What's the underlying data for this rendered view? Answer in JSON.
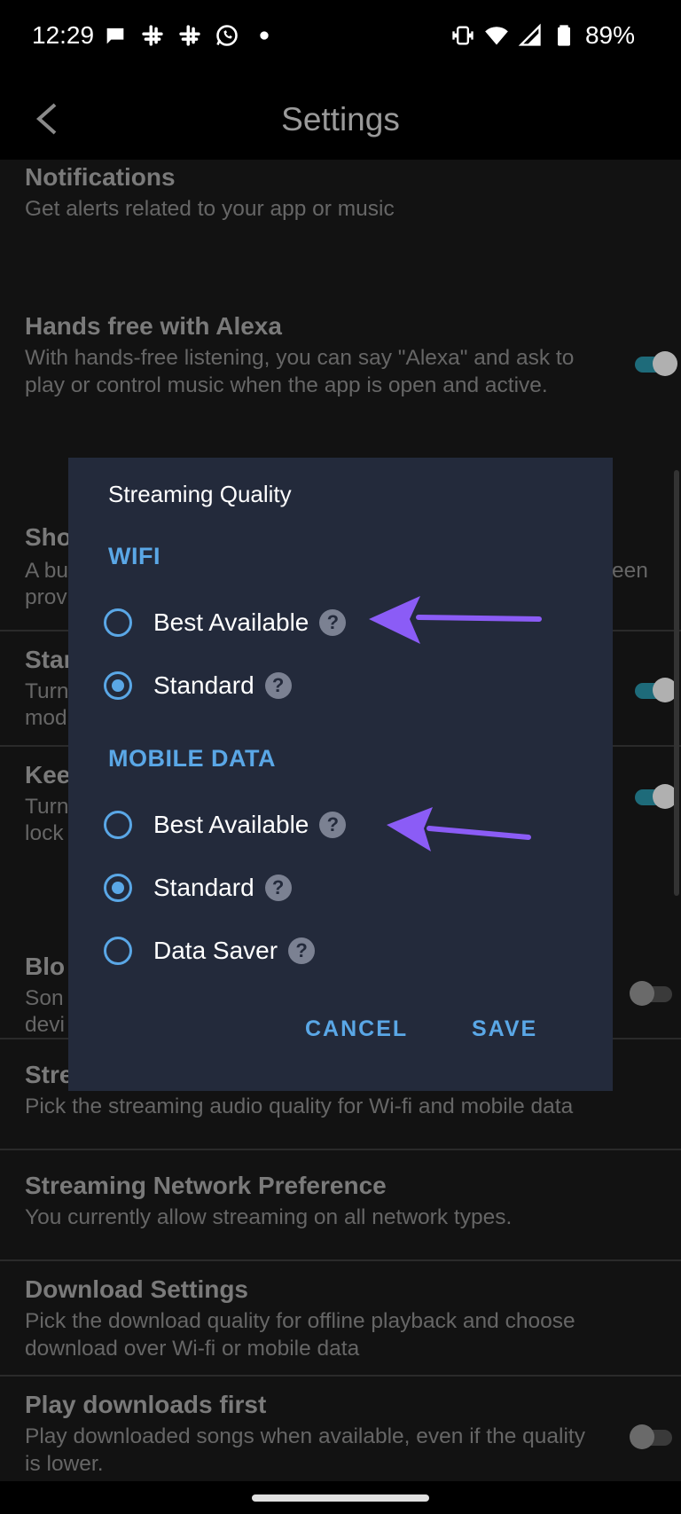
{
  "status_bar": {
    "time": "12:29",
    "battery": "89%",
    "icons": [
      "chat-bubble-icon",
      "slack-icon",
      "slack-icon",
      "whatsapp-icon",
      "dot-icon",
      "vibrate-icon",
      "wifi-icon",
      "signal-icon",
      "battery-icon"
    ]
  },
  "app_bar": {
    "title": "Settings",
    "back_icon": "chevron-left-icon"
  },
  "settings": {
    "notifications": {
      "title": "Notifications",
      "subtitle": "Get alerts related to your app or music"
    },
    "alexa": {
      "title": "Hands free with Alexa",
      "subtitle": "With hands-free listening, you can say \"Alexa\" and ask to play or control music when the app is open and active.",
      "toggle": "on"
    },
    "row3": {
      "title": "Sho",
      "subtitle_a": "A bu",
      "subtitle_b": "prov",
      "subtitle_right": "een"
    },
    "row4": {
      "title": "Star",
      "subtitle_a": "Turn",
      "subtitle_b": "mod",
      "toggle": "on"
    },
    "row5": {
      "title": "Kee",
      "subtitle_a": "Turn",
      "subtitle_b": "lock",
      "toggle": "on"
    },
    "row6": {
      "title": "Blo",
      "subtitle_a": "Son",
      "subtitle_b": "devi",
      "toggle": "off"
    },
    "streaming_quality": {
      "title": "Stre",
      "subtitle": "Pick the streaming audio quality for Wi-fi and mobile data"
    },
    "network_pref": {
      "title": "Streaming Network Preference",
      "subtitle": "You currently allow streaming on all network types."
    },
    "download": {
      "title": "Download Settings",
      "subtitle": "Pick the download quality for offline playback and choose download over Wi-fi or mobile data"
    },
    "play_downloads": {
      "title": "Play downloads first",
      "subtitle": "Play downloaded songs when available, even if the quality is lower.",
      "toggle": "off"
    }
  },
  "dialog": {
    "title": "Streaming Quality",
    "wifi_header": "WIFI",
    "wifi_options": [
      {
        "label": "Best Available",
        "selected": false
      },
      {
        "label": "Standard",
        "selected": true
      }
    ],
    "mobile_header": "MOBILE DATA",
    "mobile_options": [
      {
        "label": "Best Available",
        "selected": false
      },
      {
        "label": "Standard",
        "selected": true
      },
      {
        "label": "Data Saver",
        "selected": false
      }
    ],
    "help_glyph": "?",
    "cancel": "CANCEL",
    "save": "SAVE"
  },
  "colors": {
    "accent": "#5aa7e6",
    "dialog_bg": "#232a3b",
    "annotation_arrow": "#8b5cf6"
  }
}
